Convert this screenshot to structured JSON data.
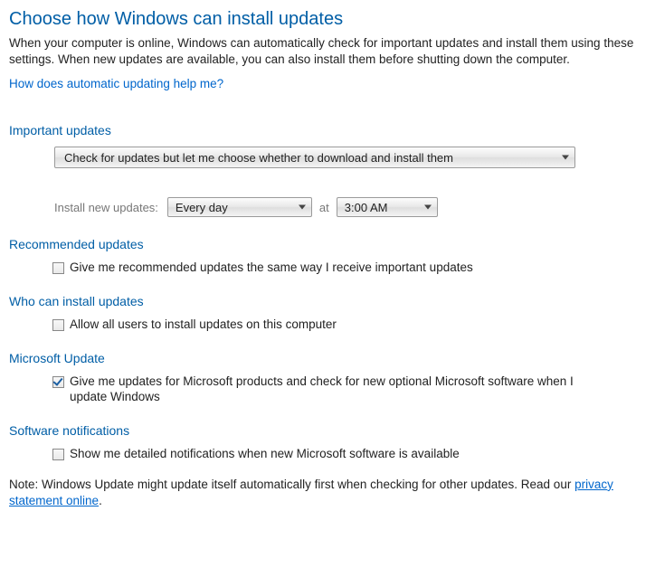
{
  "title": "Choose how Windows can install updates",
  "intro": "When your computer is online, Windows can automatically check for important updates and install them using these settings. When new updates are available, you can also install them before shutting down the computer.",
  "help_link": "How does automatic updating help me?",
  "sections": {
    "important": {
      "heading": "Important updates",
      "mode_value": "Check for updates but let me choose whether to download and install them",
      "schedule_label": "Install new updates:",
      "freq_value": "Every day",
      "at_label": "at",
      "time_value": "3:00 AM"
    },
    "recommended": {
      "heading": "Recommended updates",
      "checkbox_label": "Give me recommended updates the same way I receive important updates",
      "checked": false
    },
    "who": {
      "heading": "Who can install updates",
      "checkbox_label": "Allow all users to install updates on this computer",
      "checked": false
    },
    "microsoft": {
      "heading": "Microsoft Update",
      "checkbox_label": "Give me updates for Microsoft products and check for new optional Microsoft software when I update Windows",
      "checked": true
    },
    "software_notifications": {
      "heading": "Software notifications",
      "checkbox_label": "Show me detailed notifications when new Microsoft software is available",
      "checked": false
    }
  },
  "note_prefix": "Note: Windows Update might update itself automatically first when checking for other updates.  Read our ",
  "note_link": "privacy statement online",
  "note_suffix": "."
}
